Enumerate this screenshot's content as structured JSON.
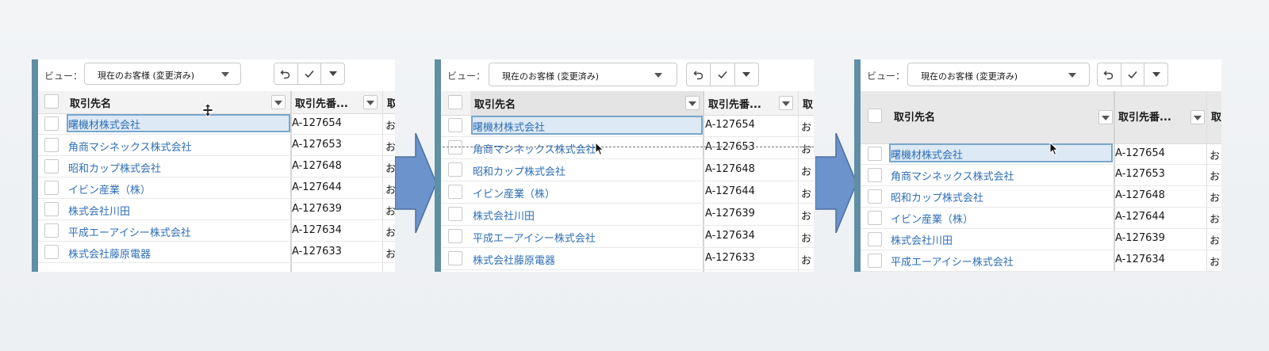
{
  "colors": {
    "accent": "#5e8fa5",
    "link": "#2f6fb6",
    "arrow": "#6c93cc",
    "selected_bg": "#dde9f4",
    "selected_border": "#7aa7c9"
  },
  "icons": {
    "undo": "undo-icon",
    "check": "check-icon",
    "dropdown": "chevron-down-icon",
    "resize_cursor": "resize-cursor-icon",
    "pointer_cursor": "pointer-cursor-icon",
    "step_arrow": "arrow-right-icon"
  },
  "panels": [
    {
      "view_label": "ビュー：",
      "view_select": "現在のお客様 (変更済み)",
      "columns": {
        "name": "取引先名",
        "number": "取引先番...",
        "more": "取引"
      },
      "rows": [
        {
          "name": "曙機材株式会社",
          "id": "A-127654",
          "more": "お"
        },
        {
          "name": "角商マシネックス株式会社",
          "id": "A-127653",
          "more": "お"
        },
        {
          "name": "昭和カップ株式会社",
          "id": "A-127648",
          "more": "お"
        },
        {
          "name": "イビン産業（株）",
          "id": "A-127644",
          "more": "お"
        },
        {
          "name": "株式会社川田",
          "id": "A-127639",
          "more": "お"
        },
        {
          "name": "平成エーアイシー株式会社",
          "id": "A-127634",
          "more": "お"
        },
        {
          "name": "株式会社藤原電器",
          "id": "A-127633",
          "more": "お"
        }
      ]
    },
    {
      "view_label": "ビュー：",
      "view_select": "現在のお客様 (変更済み)",
      "columns": {
        "name": "取引先名",
        "number": "取引先番...",
        "more": "取"
      },
      "rows": [
        {
          "name": "曙機材株式会社",
          "id": "A-127654",
          "more": "お"
        },
        {
          "name": "角商マシネックス株式会社",
          "id": "A-127653",
          "more": "お"
        },
        {
          "name": "昭和カップ株式会社",
          "id": "A-127648",
          "more": "お"
        },
        {
          "name": "イビン産業（株）",
          "id": "A-127644",
          "more": "お"
        },
        {
          "name": "株式会社川田",
          "id": "A-127639",
          "more": "お"
        },
        {
          "name": "平成エーアイシー株式会社",
          "id": "A-127634",
          "more": "お"
        },
        {
          "name": "株式会社藤原電器",
          "id": "A-127633",
          "more": "お"
        }
      ]
    },
    {
      "view_label": "ビュー：",
      "view_select": "現在のお客様 (変更済み)",
      "columns": {
        "name": "取引先名",
        "number": "取引先番...",
        "more": "取"
      },
      "rows": [
        {
          "name": "曙機材株式会社",
          "id": "A-127654",
          "more": "お"
        },
        {
          "name": "角商マシネックス株式会社",
          "id": "A-127653",
          "more": "お"
        },
        {
          "name": "昭和カップ株式会社",
          "id": "A-127648",
          "more": "お"
        },
        {
          "name": "イビン産業（株）",
          "id": "A-127644",
          "more": "お"
        },
        {
          "name": "株式会社川田",
          "id": "A-127639",
          "more": "お"
        },
        {
          "name": "平成エーアイシー株式会社",
          "id": "A-127634",
          "more": "お"
        }
      ]
    }
  ]
}
